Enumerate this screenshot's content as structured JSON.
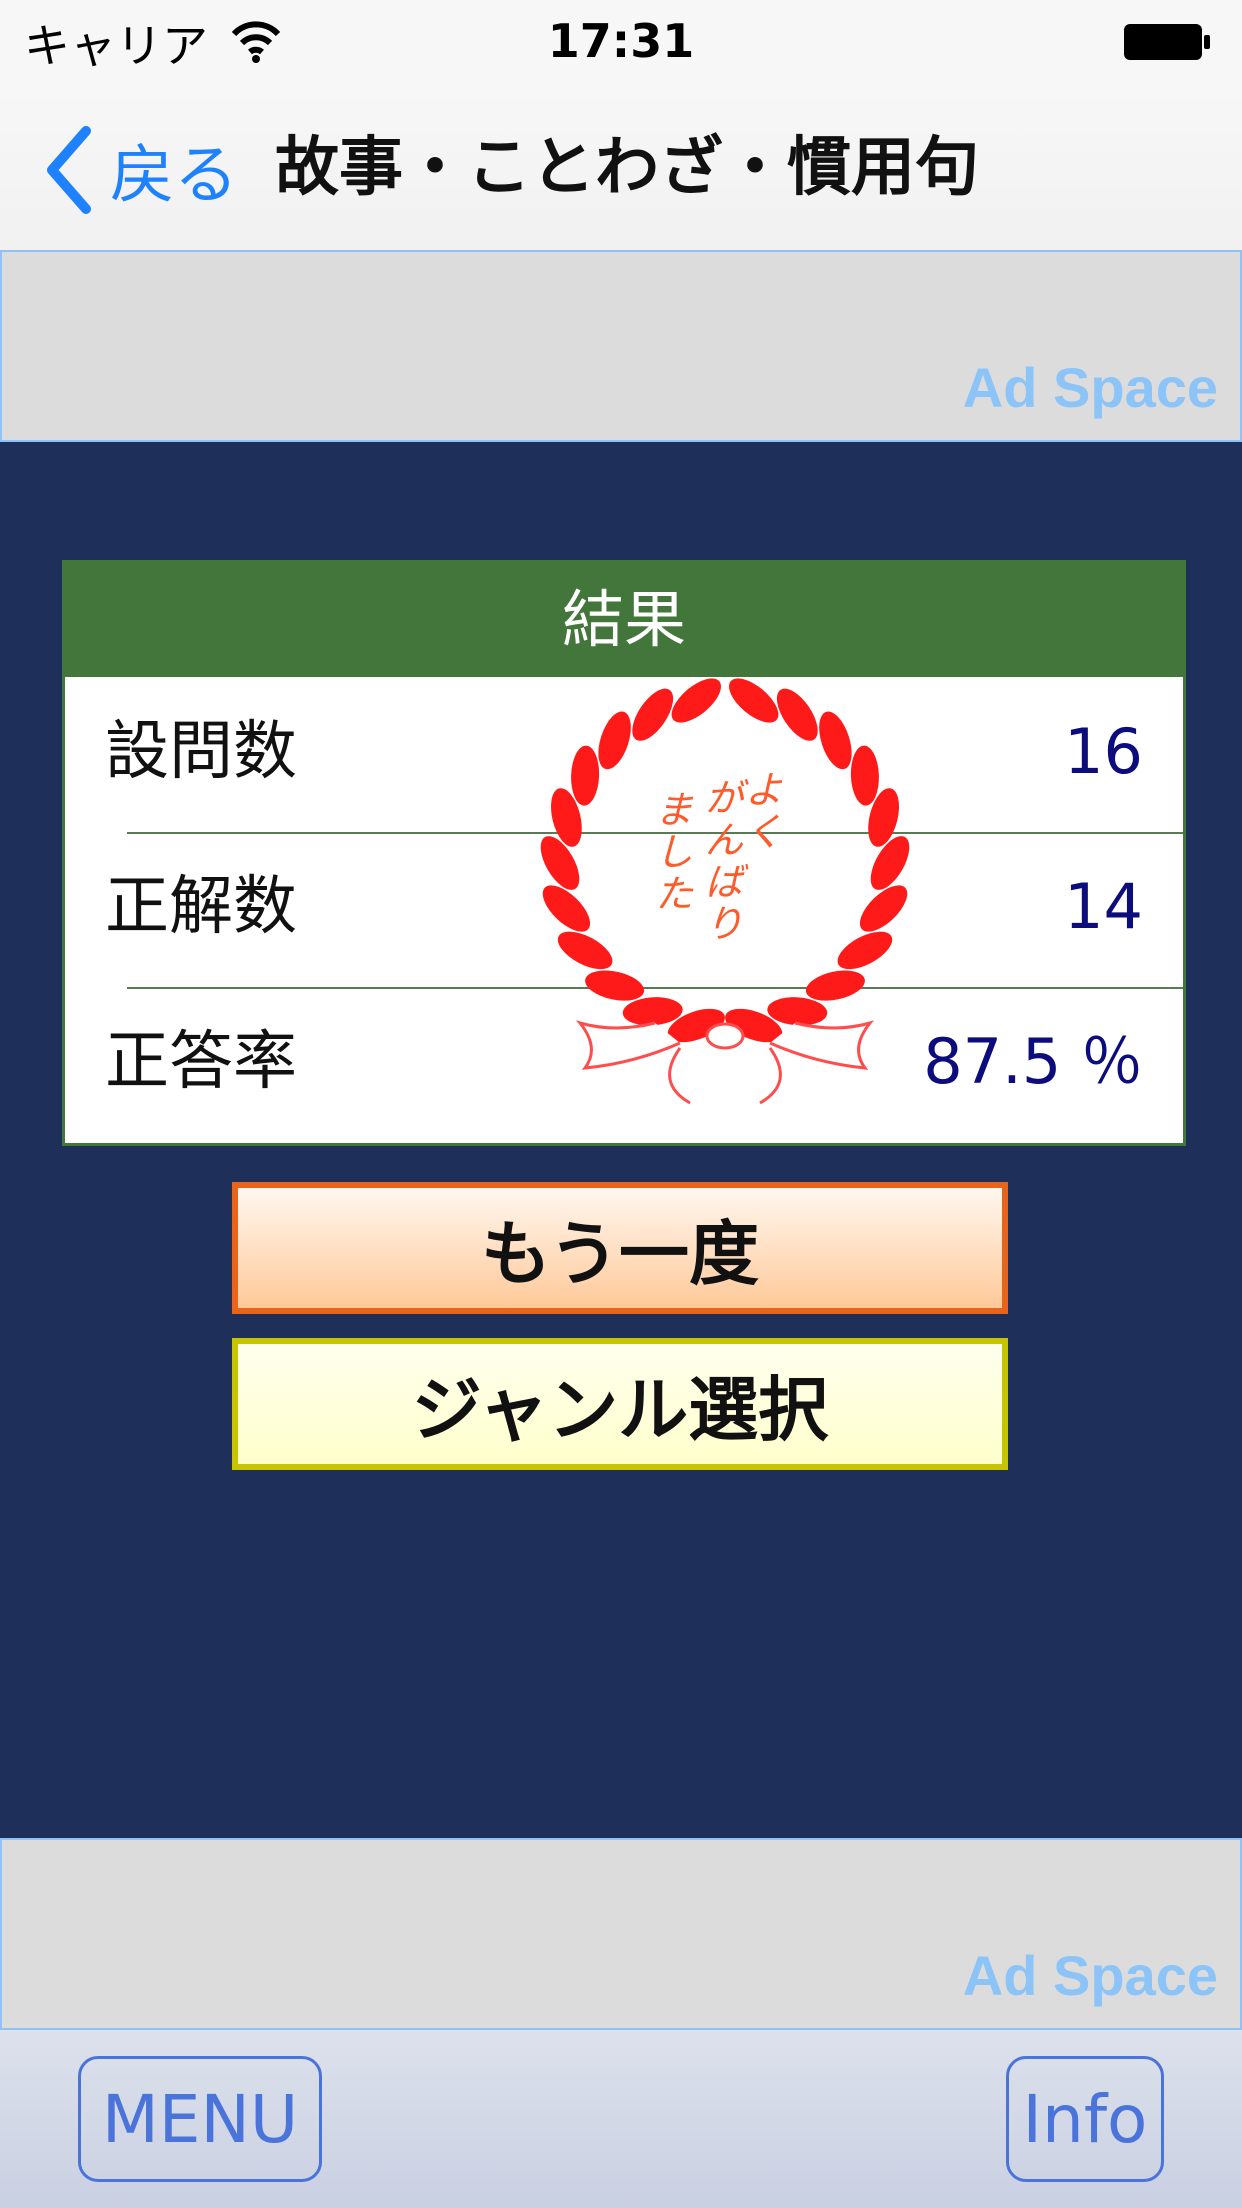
{
  "status_bar": {
    "carrier": "キャリア",
    "time": "17:31",
    "wifi_icon": "wifi-icon",
    "battery_icon": "battery-icon"
  },
  "nav": {
    "back_label": "戻る",
    "back_icon": "chevron-left-icon",
    "title": "故事・ことわざ・慣用句"
  },
  "ads": {
    "top_label": "Ad Space",
    "bottom_label": "Ad Space"
  },
  "result": {
    "header": "結果",
    "rows": [
      {
        "label": "設問数",
        "value": "16"
      },
      {
        "label": "正解数",
        "value": "14"
      },
      {
        "label": "正答率",
        "value": "87.5 ％"
      }
    ],
    "stamp_text": "よくがんばりました",
    "stamp_icon": "laurel-wreath-icon"
  },
  "buttons": {
    "retry": "もう一度",
    "genre": "ジャンル選択"
  },
  "toolbar": {
    "menu": "MENU",
    "info": "Info"
  },
  "colors": {
    "background": "#1e3059",
    "header_green": "#43763a",
    "accent_blue": "#1e82ff",
    "value_navy": "#0c0c7d",
    "stamp_red": "#ff1a1a"
  }
}
